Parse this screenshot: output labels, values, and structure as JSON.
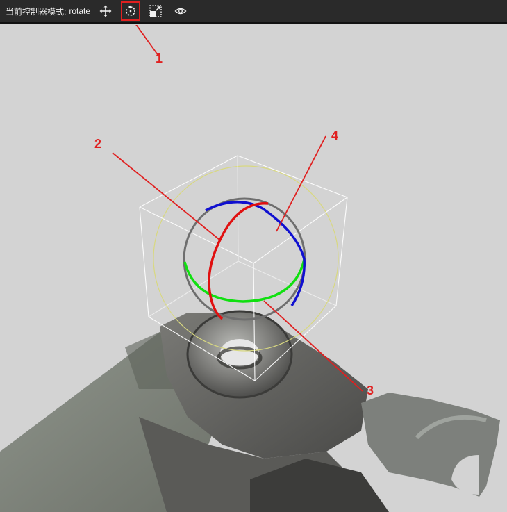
{
  "toolbar": {
    "mode_label": "当前控制器模式:",
    "mode_value": "rotate",
    "buttons": [
      {
        "icon": "move-icon",
        "active": false
      },
      {
        "icon": "rotate-icon",
        "active": true
      },
      {
        "icon": "scale-icon",
        "active": false
      },
      {
        "icon": "eye-icon",
        "active": false
      }
    ]
  },
  "callouts": {
    "one": "1",
    "two": "2",
    "three": "3",
    "four": "4"
  },
  "colors": {
    "x_axis": "#e01010",
    "y_axis": "#10e010",
    "z_axis": "#1010d0",
    "view_ring": "#d8d880",
    "outline": "#ffffff",
    "callout": "#e02020",
    "background": "#d3d3d3"
  }
}
